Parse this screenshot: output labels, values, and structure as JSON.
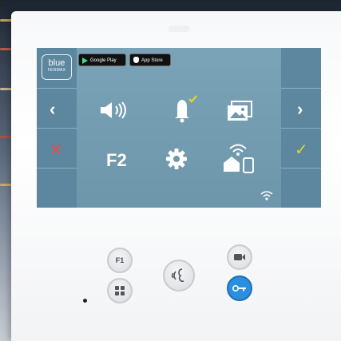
{
  "screen": {
    "logo_text": "blue",
    "logo_sub": "FERMAX",
    "google_play": "Google Play",
    "app_store": "App Store",
    "f2_label": "F2"
  },
  "buttons": {
    "f1_label": "F1"
  },
  "colors": {
    "screen_bg": "#6f98ad",
    "side_col": "#5c879e",
    "cancel_red": "#e84a4a",
    "accept_yellow": "#e8d12a",
    "door_blue": "#2b8fe0"
  }
}
